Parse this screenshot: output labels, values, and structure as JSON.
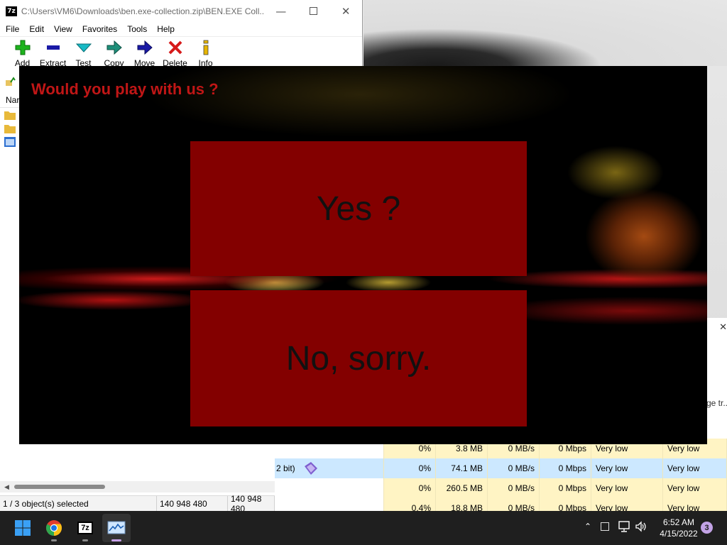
{
  "zip": {
    "app_icon": "7z",
    "title": "C:\\Users\\VM6\\Downloads\\ben.exe-collection.zip\\BEN.EXE Coll...",
    "menu": [
      "File",
      "Edit",
      "View",
      "Favorites",
      "Tools",
      "Help"
    ],
    "toolbar": [
      {
        "label": "Add",
        "icon": "add-icon"
      },
      {
        "label": "Extract",
        "icon": "extract-icon"
      },
      {
        "label": "Test",
        "icon": "test-icon"
      },
      {
        "label": "Copy",
        "icon": "copy-icon"
      },
      {
        "label": "Move",
        "icon": "move-icon"
      },
      {
        "label": "Delete",
        "icon": "delete-icon"
      },
      {
        "label": "Info",
        "icon": "info-icon"
      }
    ],
    "list_header_fragment": "Nar",
    "status": {
      "selected": "1 / 3 object(s) selected",
      "size1": "140 948 480",
      "size2": "140 948 480"
    },
    "colors": {
      "add": "#1db31d",
      "extract": "#1a1aa6",
      "test": "#18b9c4",
      "copy": "#1e8f7a",
      "move": "#1a1aa6",
      "delete": "#d61a1a",
      "info": "#e6b400"
    }
  },
  "game": {
    "prompt": "Would you play with us ?",
    "yes_label": "Yes ?",
    "no_label": "No, sorry.",
    "colors": {
      "prompt": "#c01616",
      "button": "#830000"
    }
  },
  "taskmgr": {
    "fragment_label": "ge tr...",
    "rows": [
      {
        "name": "",
        "cpu": "0%",
        "memory": "3.8 MB",
        "disk": "0 MB/s",
        "network": "0 Mbps",
        "power": "Very low",
        "power_trend": "Very low"
      },
      {
        "name": "2 bit)",
        "cpu": "0%",
        "memory": "74.1 MB",
        "disk": "0 MB/s",
        "network": "0 Mbps",
        "power": "Very low",
        "power_trend": "Very low"
      },
      {
        "name": "",
        "cpu": "0%",
        "memory": "260.5 MB",
        "disk": "0 MB/s",
        "network": "0 Mbps",
        "power": "Very low",
        "power_trend": "Very low"
      },
      {
        "name": "",
        "cpu": "0.4%",
        "memory": "18.8 MB",
        "disk": "0 MB/s",
        "network": "0 Mbps",
        "power": "Very low",
        "power_trend": "Very low"
      }
    ]
  },
  "taskbar": {
    "clock_time": "6:52 AM",
    "clock_date": "4/15/2022",
    "notification_count": "3",
    "zip_app_label": "7z"
  }
}
